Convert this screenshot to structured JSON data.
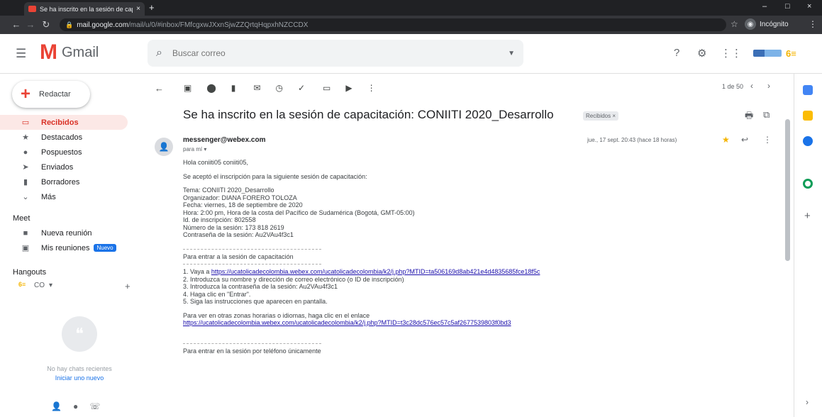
{
  "browser": {
    "tab_title": "Se ha inscrito en la sesión de cap",
    "tab_close": "×",
    "new_tab": "+",
    "url_host": "mail.google.com",
    "url_path": "/mail/u/0/#inbox/FMfcgxwJXxnSjwZZQrtqHqpxhNZCCDX",
    "incognito_label": "Incógnito",
    "win_min": "–",
    "win_max": "□",
    "win_close": "×"
  },
  "header": {
    "app_name": "Gmail",
    "search_placeholder": "Buscar correo"
  },
  "sidebar": {
    "compose_label": "Redactar",
    "items": [
      {
        "label": "Recibidos",
        "icon": "inbox-icon",
        "active": true
      },
      {
        "label": "Destacados",
        "icon": "star-icon"
      },
      {
        "label": "Pospuestos",
        "icon": "clock-icon"
      },
      {
        "label": "Enviados",
        "icon": "send-icon"
      },
      {
        "label": "Borradores",
        "icon": "draft-icon"
      },
      {
        "label": "Más",
        "icon": "chevron-down-icon"
      }
    ],
    "meet_title": "Meet",
    "meet_items": [
      {
        "label": "Nueva reunión",
        "icon": "video-icon"
      },
      {
        "label": "Mis reuniones",
        "icon": "calendar-icon",
        "badge": "Nuevo"
      }
    ],
    "hangouts_title": "Hangouts",
    "hangouts_user": "CO",
    "no_chats": "No hay chats recientes",
    "start_new": "Iniciar uno nuevo"
  },
  "toolbar": {
    "pager": "1 de 50"
  },
  "email": {
    "subject": "Se ha inscrito en la sesión de capacitación: CONIITI 2020_Desarrollo",
    "label_chip": "Recibidos ×",
    "sender": "messenger@webex.com",
    "to": "para mí ▾",
    "date": "jue., 17 sept. 20:43 (hace 18 horas)",
    "lines": {
      "greeting": "Hola coniiti05 coniiti05,",
      "intro": "Se aceptó el inscripción para la siguiente sesión de capacitación:",
      "tema": "Tema: CONIITI 2020_Desarrollo",
      "organizer": "Organizador: DIANA FORERO TOLOZA",
      "fecha": "Fecha: viernes, 18 de septiembre de 2020",
      "hora": "Hora: 2:00 pm, Hora de la costa del Pacífico de Sudamérica (Bogotá, GMT-05:00)",
      "id": "Id. de inscripción: 802558",
      "numero": "Número de la sesión: 173 818 2619",
      "password": "Contraseña de la sesión: Au2VAu4f3c1",
      "enter_title": "Para entrar a la sesión de capacitación",
      "step1_prefix": "1. Vaya a ",
      "step1_link": "https://ucatolicadecolombia.webex.com/ucatolicadecolombia/k2/j.php?MTID=ta506169d8ab421e4d4835685fce18f5c",
      "step2": "2. Introduzca su nombre y dirección de correo electrónico (o ID de inscripción)",
      "step3": "3. Introduzca la contraseña de la sesión: Au2VAu4f3c1",
      "step4": "4. Haga clic en \"Entrar\".",
      "step5": "5. Siga las instrucciones que aparecen en pantalla.",
      "tz_text": "Para ver en otras zonas horarias o idiomas, haga clic en el enlace",
      "tz_link": "https://ucatolicadecolombia.webex.com/ucatolicadecolombia/k2/j.php?MTID=t3c28dc576ec57c5af2677539803f0bd3",
      "phone_title": "Para entrar en la sesión por teléfono únicamente"
    }
  },
  "colors": {
    "accent_red": "#ea4335",
    "active_bg": "#fce8e6",
    "link": "#1a0dab"
  }
}
